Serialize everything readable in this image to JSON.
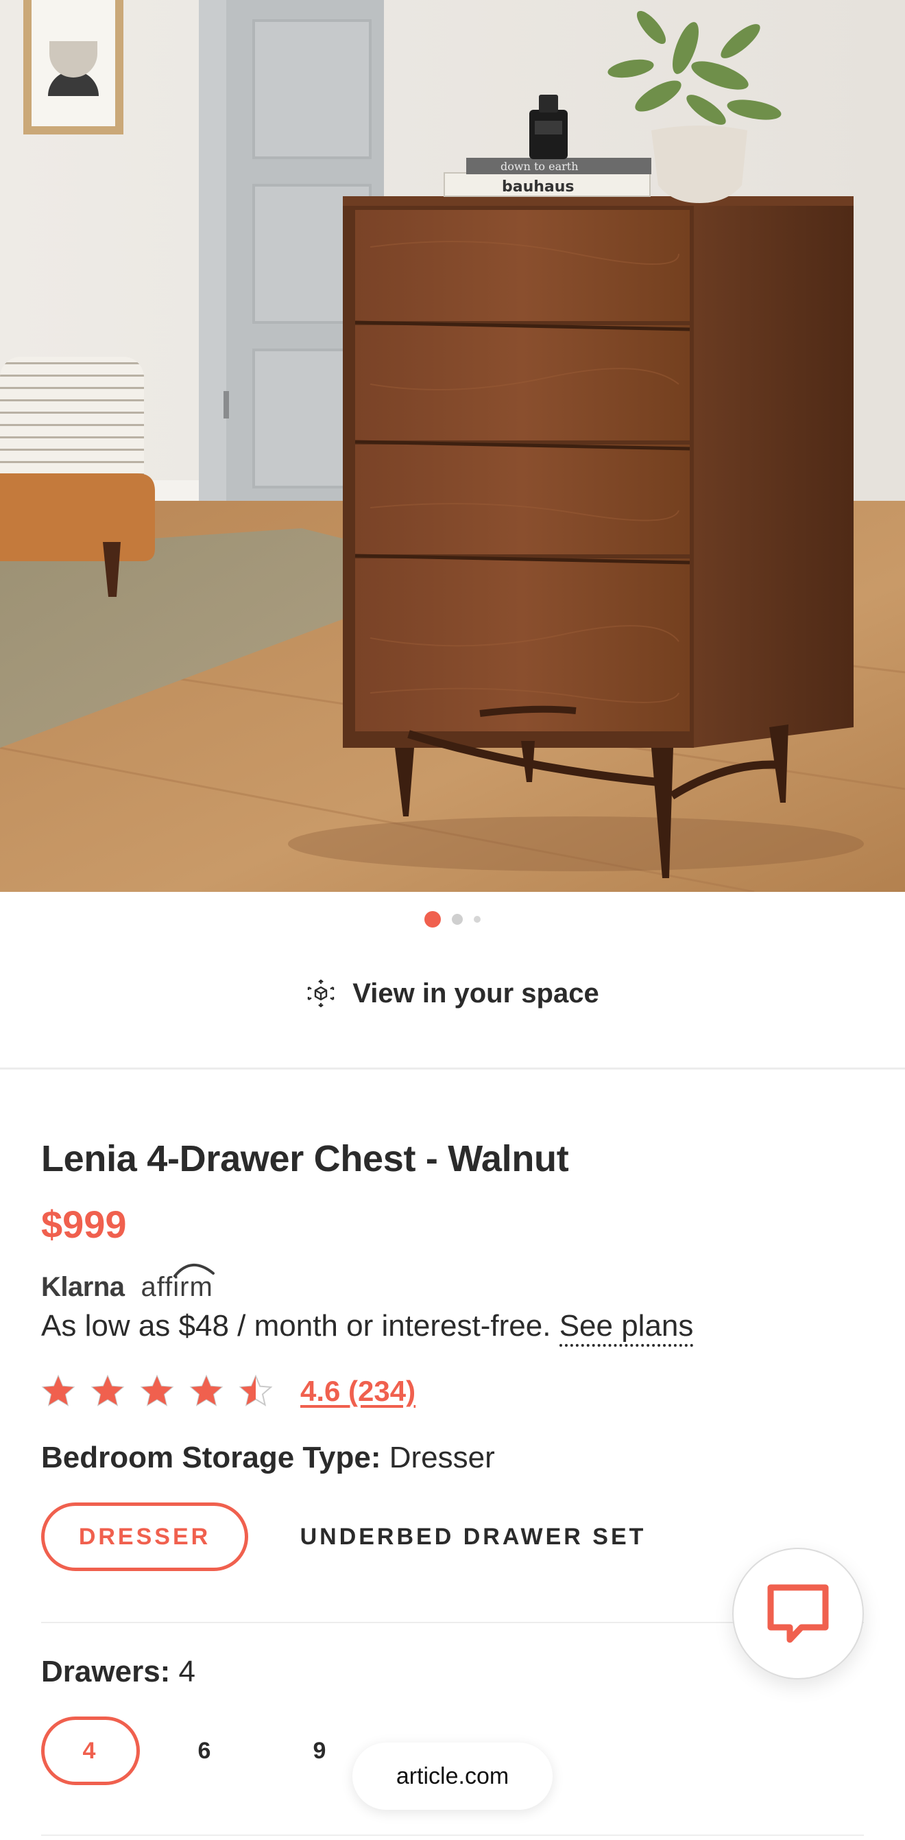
{
  "colors": {
    "accent": "#f0604e",
    "text": "#2b2b2b",
    "divider": "#ececec"
  },
  "gallery": {
    "image_alt": "Walnut 4-drawer chest in a bedroom",
    "book_top_text": "down to earth",
    "book_bottom_text": "bauhaus",
    "slide_count": 3,
    "active_slide": 1
  },
  "view_in_space": {
    "icon": "ar-cube-icon",
    "label": "View in your space"
  },
  "product": {
    "title": "Lenia 4-Drawer Chest - Walnut",
    "price": "$999",
    "financing": {
      "provider_1": "Klarna",
      "provider_2": "affirm",
      "text": "As low as $48 / month or interest-free.",
      "link": "See plans"
    },
    "rating": {
      "value": 4.6,
      "stars_max": 5,
      "label": "4.6 (234)"
    }
  },
  "options": {
    "storage_type": {
      "label": "Bedroom Storage Type:",
      "value": "Dresser",
      "choices": [
        "DRESSER",
        "UNDERBED DRAWER SET"
      ],
      "selected": 0
    },
    "drawers": {
      "label": "Drawers:",
      "value": "4",
      "choices": [
        "4",
        "6",
        "9"
      ],
      "selected": 0
    }
  },
  "chat": {
    "icon": "chat-bubble-icon"
  },
  "browser": {
    "url": "article.com"
  }
}
